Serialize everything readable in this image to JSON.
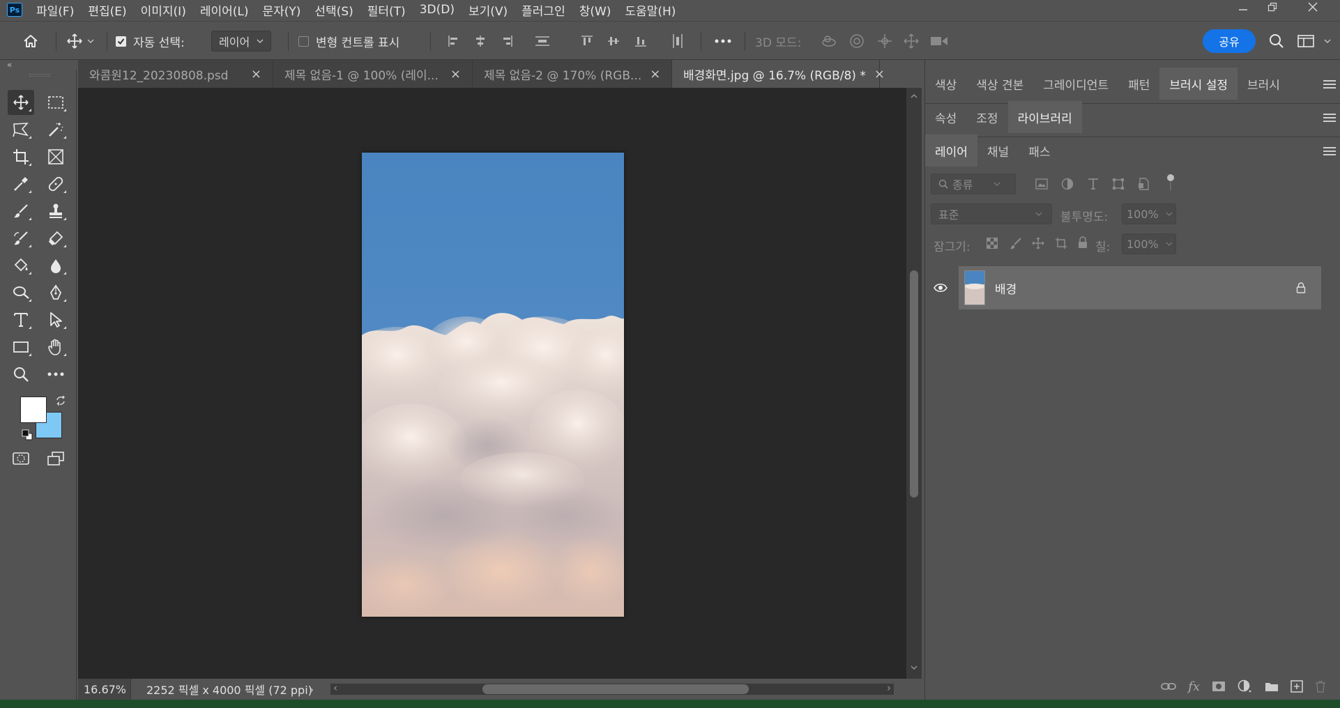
{
  "app": {
    "logo": "Ps"
  },
  "menu": [
    "파일(F)",
    "편집(E)",
    "이미지(I)",
    "레이어(L)",
    "문자(Y)",
    "선택(S)",
    "필터(T)",
    "3D(D)",
    "보기(V)",
    "플러그인",
    "창(W)",
    "도움말(H)"
  ],
  "options": {
    "auto_select_label": "자동 선택:",
    "auto_select_checked": true,
    "auto_select_target": "레이어",
    "show_transform_label": "변형 컨트롤 표시",
    "show_transform_checked": false,
    "mode_3d_label": "3D 모드:",
    "share_label": "공유"
  },
  "tabs": [
    {
      "label": "와콤원12_20230808.psd",
      "active": false
    },
    {
      "label": "제목 없음-1 @ 100% (레이...",
      "active": false
    },
    {
      "label": "제목 없음-2 @ 170% (RGB...",
      "active": false
    },
    {
      "label": "배경화면.jpg @ 16.7% (RGB/8) *",
      "active": true
    }
  ],
  "status": {
    "zoom": "16.67%",
    "doc_info": "2252 픽셀 x 4000 픽셀 (72 ppi)"
  },
  "tools": [
    "move-tool",
    "marquee-tool",
    "lasso-tool",
    "magic-wand-tool",
    "crop-tool",
    "frame-tool",
    "eyedropper-tool",
    "healing-brush-tool",
    "brush-tool",
    "clone-stamp-tool",
    "history-brush-tool",
    "eraser-tool",
    "paint-bucket-tool",
    "blur-tool",
    "dodge-tool",
    "pen-tool",
    "type-tool",
    "path-selection-tool",
    "rectangle-tool",
    "hand-tool",
    "zoom-tool",
    "more-tools"
  ],
  "colors": {
    "foreground": "#ffffff",
    "background": "#7ec8f5",
    "accent": "#1473e6"
  },
  "panels": {
    "group1_tabs": [
      {
        "label": "색상",
        "active": false
      },
      {
        "label": "색상 견본",
        "active": false
      },
      {
        "label": "그레이디언트",
        "active": false
      },
      {
        "label": "패턴",
        "active": false
      },
      {
        "label": "브러시 설정",
        "active": true
      },
      {
        "label": "브러시",
        "active": false
      }
    ],
    "group2_tabs": [
      {
        "label": "속성",
        "active": false
      },
      {
        "label": "조정",
        "active": false
      },
      {
        "label": "라이브러리",
        "active": true
      }
    ],
    "group3_tabs": [
      {
        "label": "레이어",
        "active": true
      },
      {
        "label": "채널",
        "active": false
      },
      {
        "label": "패스",
        "active": false
      }
    ]
  },
  "layers": {
    "filter_kind": "종류",
    "blend_mode": "표준",
    "opacity_label": "불투명도:",
    "opacity_value": "100%",
    "lock_label": "잠그기:",
    "fill_label": "칠:",
    "fill_value": "100%",
    "items": [
      {
        "name": "배경",
        "visible": true,
        "locked": true
      }
    ]
  }
}
